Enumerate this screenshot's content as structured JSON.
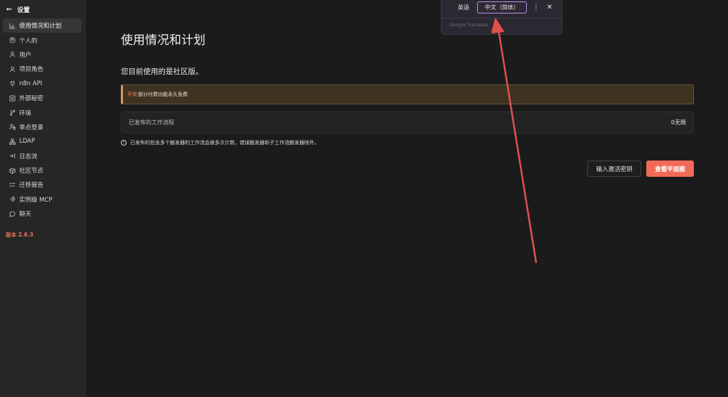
{
  "sidebar": {
    "back_label": "设置",
    "items": [
      {
        "label": "使用情况和计划",
        "icon": "bar-chart-icon",
        "active": true
      },
      {
        "label": "个人的",
        "icon": "user-circle-icon"
      },
      {
        "label": "用户",
        "icon": "user-icon"
      },
      {
        "label": "项目角色",
        "icon": "user-icon"
      },
      {
        "label": "n8n API",
        "icon": "plug-icon"
      },
      {
        "label": "外部秘密",
        "icon": "vault-icon"
      },
      {
        "label": "环境",
        "icon": "git-branch-icon"
      },
      {
        "label": "单点登录",
        "icon": "user-lock-icon"
      },
      {
        "label": "LDAP",
        "icon": "network-icon"
      },
      {
        "label": "日志流",
        "icon": "sign-in-icon"
      },
      {
        "label": "社区节点",
        "icon": "cube-icon"
      },
      {
        "label": "迁移报告",
        "icon": "list-check-icon"
      },
      {
        "label": "实例级 MCP",
        "icon": "mcp-icon"
      },
      {
        "label": "聊天",
        "icon": "chat-icon"
      }
    ],
    "version": "版本 2.6.3"
  },
  "main": {
    "title": "使用情况和计划",
    "plan_text": "您目前使用的是社区版。",
    "banner": {
      "link": "开锁",
      "text": "部分付费功能永久免费"
    },
    "workflows": {
      "label": "已发布的工作流程",
      "value": "0无限"
    },
    "note": "已发布的包含多个触发器的工作流会被多次计数。错误触发器和子工作流触发器除外。",
    "buttons": {
      "activation_key": "输入激活密钥",
      "view_plans": "查看平面图"
    }
  },
  "translate_popup": {
    "source_lang": "英语",
    "target_lang": "中文（简体）",
    "brand": "Google Translate"
  },
  "colors": {
    "accent": "#f16a58",
    "annotation_arrow": "#e0504f",
    "banner_border": "#d99a59",
    "selected_lang_border": "#b596e8"
  }
}
